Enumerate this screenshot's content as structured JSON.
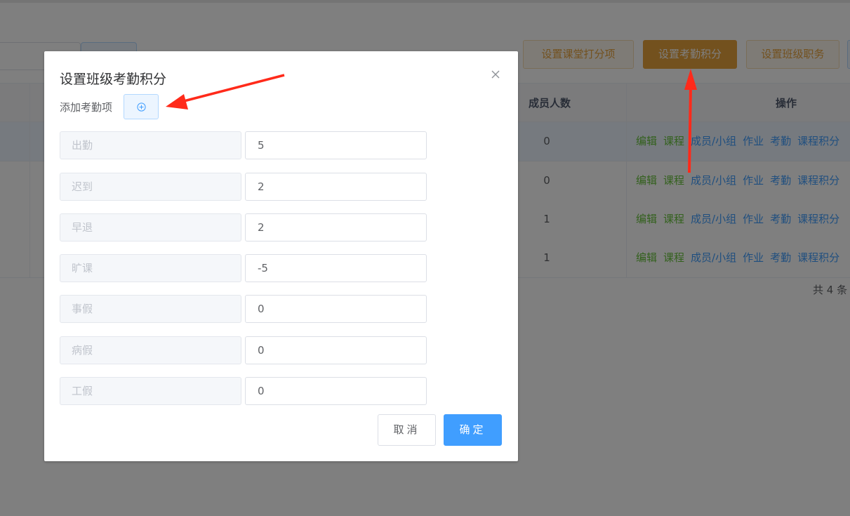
{
  "toolbar": {
    "search_button_label": "",
    "buttons": [
      "设置课堂打分项",
      "设置考勤积分",
      "设置班级职务"
    ]
  },
  "table": {
    "headers": {
      "members": "成员人数",
      "operations": "操作"
    },
    "rows": [
      {
        "members": "0"
      },
      {
        "members": "0"
      },
      {
        "members": "1"
      },
      {
        "members": "1"
      }
    ],
    "ops_green": [
      "编辑",
      "课程"
    ],
    "ops_blue": [
      "成员/小组",
      "作业",
      "考勤",
      "课程积分"
    ],
    "total": "共 4 条"
  },
  "dialog": {
    "title": "设置班级考勤积分",
    "add_label": "添加考勤项",
    "items": [
      {
        "name": "出勤",
        "score": "5"
      },
      {
        "name": "迟到",
        "score": "2"
      },
      {
        "name": "早退",
        "score": "2"
      },
      {
        "name": "旷课",
        "score": "-5"
      },
      {
        "name": "事假",
        "score": "0"
      },
      {
        "name": "病假",
        "score": "0"
      },
      {
        "name": "工假",
        "score": "0"
      }
    ],
    "cancel_label": "取消",
    "confirm_label": "确定"
  },
  "colors": {
    "primary": "#409eff",
    "warning": "#e6a23c",
    "success": "#67c23a",
    "annotation_arrow": "#ff2a1a"
  },
  "icons": {
    "close": "close-icon",
    "add": "plus-circle-icon"
  }
}
